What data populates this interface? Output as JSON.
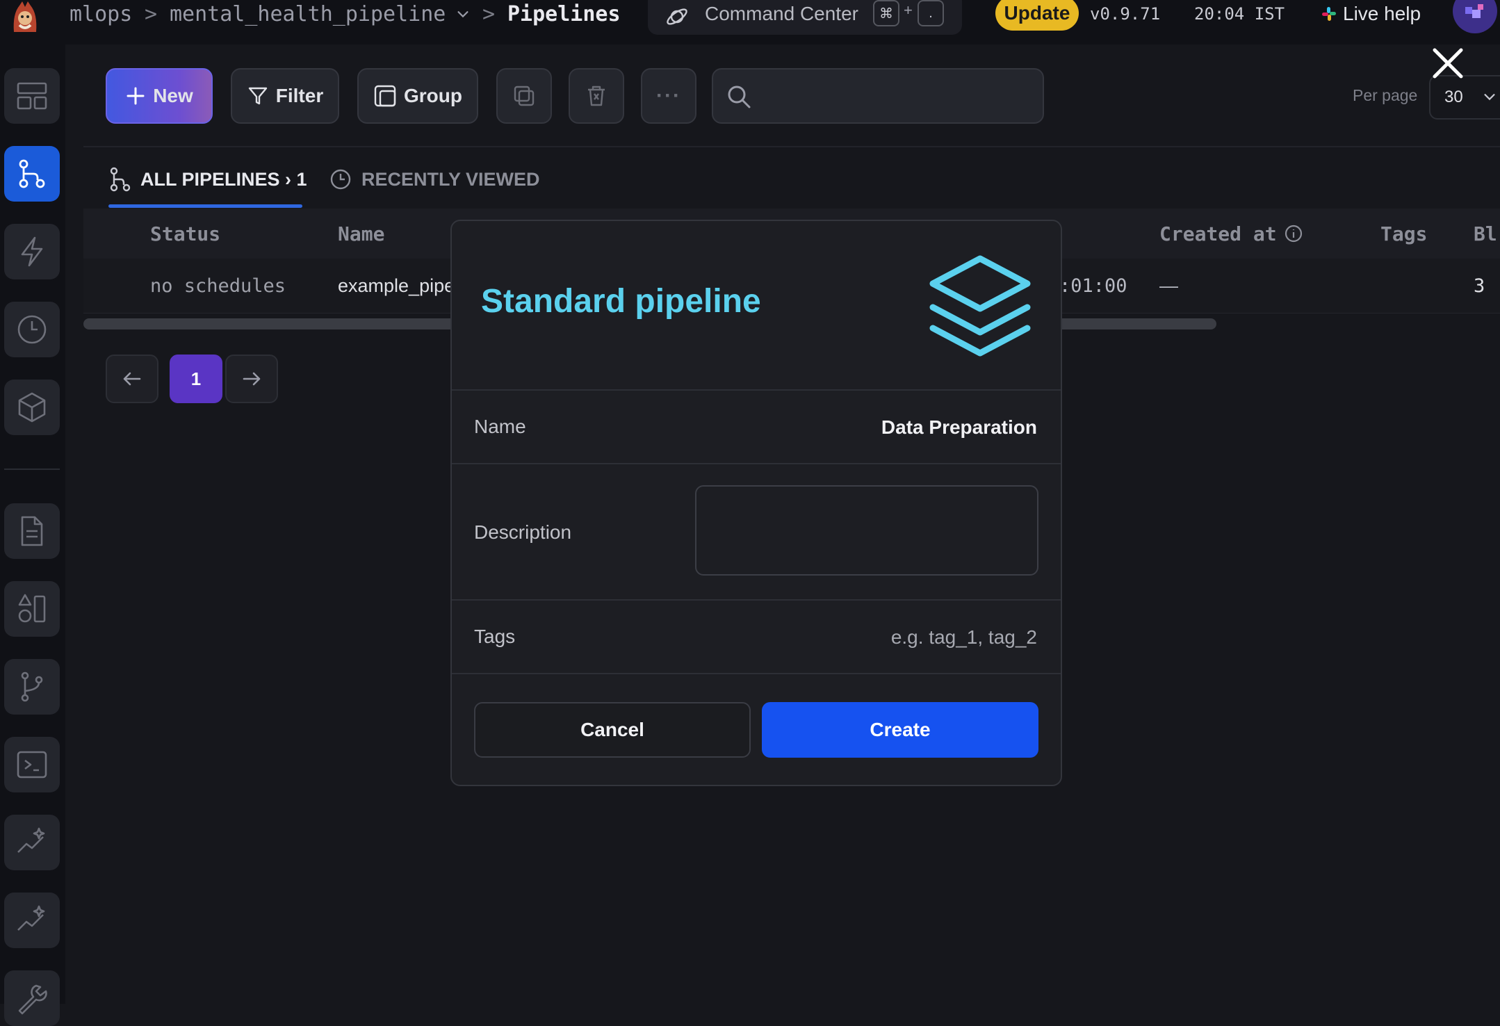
{
  "topbar": {
    "breadcrumb": {
      "project": "mlops",
      "pipeline": "mental_health_pipeline",
      "current": "Pipelines",
      "separator": ">"
    },
    "command_center": {
      "label": "Command Center",
      "shortcut_key_1": "⌘",
      "shortcut_plus": "+",
      "shortcut_key_2": "."
    },
    "update_label": "Update",
    "version": "v0.9.71",
    "time": "20:04 IST",
    "live_help": "Live help"
  },
  "sidebar": {
    "items": [
      {
        "name": "dashboard",
        "icon": "layout-icon"
      },
      {
        "name": "pipelines",
        "icon": "pipeline-icon",
        "active": true
      },
      {
        "name": "triggers",
        "icon": "lightning-icon"
      },
      {
        "name": "pipeline-runs",
        "icon": "clock-icon"
      },
      {
        "name": "block-runs",
        "icon": "cube-icon"
      },
      {
        "name": "files",
        "icon": "document-icon"
      },
      {
        "name": "templates",
        "icon": "shapes-icon"
      },
      {
        "name": "version-control",
        "icon": "git-branch-icon"
      },
      {
        "name": "terminal",
        "icon": "terminal-icon"
      },
      {
        "name": "monitoring",
        "icon": "chart-sparkle-icon"
      },
      {
        "name": "monitoring-2",
        "icon": "chart-sparkle-icon"
      },
      {
        "name": "settings",
        "icon": "wrench-icon"
      }
    ]
  },
  "toolbar": {
    "new_label": "New",
    "filter_label": "Filter",
    "group_label": "Group",
    "more_label": "···",
    "search_placeholder": "",
    "per_page_label": "Per page",
    "per_page_value": "30"
  },
  "tabs": {
    "all": "ALL PIPELINES › 1",
    "recent": "RECENTLY VIEWED"
  },
  "table": {
    "columns": [
      "Status",
      "Name",
      "Created at",
      "Tags",
      "Bl"
    ],
    "rows": [
      {
        "status": "no schedules",
        "name": "example_pipe",
        "updated_partial": ":01:00",
        "created_at": "—",
        "blocks": "3"
      }
    ]
  },
  "pagination": {
    "current_page": "1",
    "prev_icon": "arrow-left-icon",
    "next_icon": "arrow-right-icon"
  },
  "modal": {
    "title": "Standard pipeline",
    "icon": "layers-icon",
    "name_label": "Name",
    "name_value": "Data Preparation",
    "description_label": "Description",
    "description_value": "",
    "tags_label": "Tags",
    "tags_placeholder": "e.g. tag_1, tag_2",
    "cancel_label": "Cancel",
    "create_label": "Create"
  },
  "colors": {
    "accent_blue": "#1652f0",
    "modal_title": "#5bd1ee",
    "update_badge": "#e8b923",
    "active_page": "#5a35c4"
  }
}
